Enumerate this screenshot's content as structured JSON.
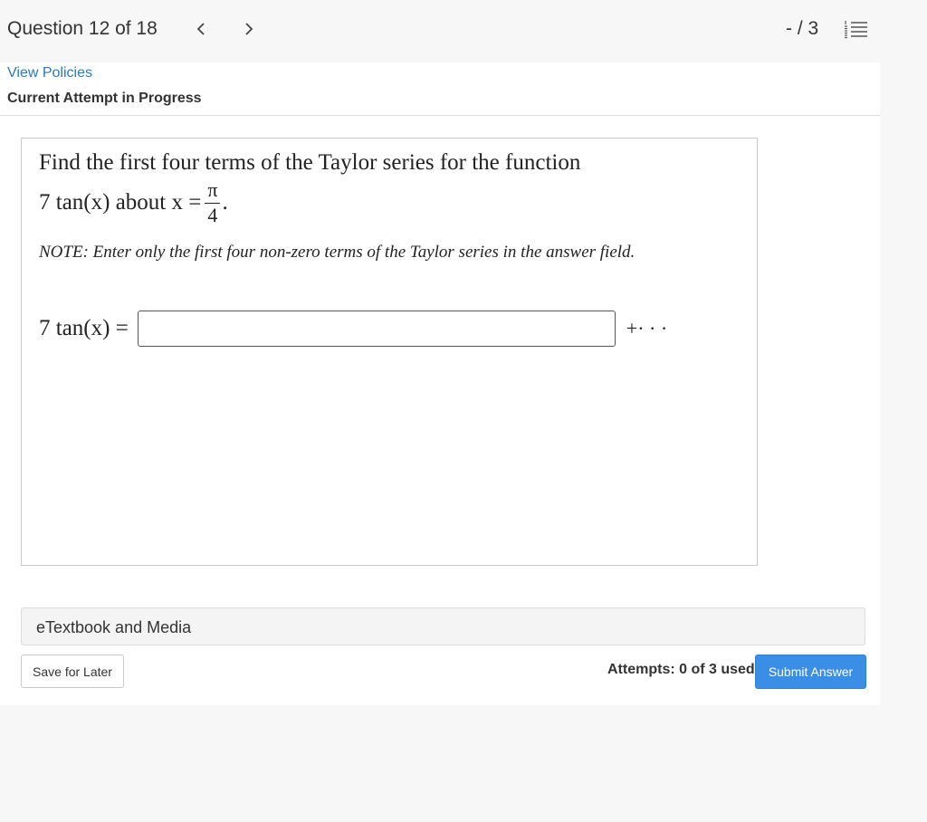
{
  "header": {
    "question_label": "Question 12 of 18",
    "prev_icon": "chevron-left-icon",
    "next_icon": "chevron-right-icon",
    "score": "- / 3",
    "list_icon": "numbered-list-icon"
  },
  "card": {
    "policies_link": "View Policies",
    "attempt_status": "Current Attempt in Progress"
  },
  "question": {
    "line1": "Find the first four terms of the Taylor series for the function",
    "line2_pre": "7 tan(x) about x =",
    "frac_num": "π",
    "frac_den": "4",
    "line2_post": ".",
    "note": "NOTE: Enter only the first four non-zero terms of the Taylor series in the answer field.",
    "answer_lhs": "7 tan(x) =",
    "answer_value": "",
    "answer_suffix": "+· · ·"
  },
  "etextbook": {
    "label": "eTextbook and Media"
  },
  "footer": {
    "save_label": "Save for Later",
    "attempts_text": "Attempts: 0 of 3 used",
    "submit_label": "Submit Answer"
  },
  "colors": {
    "link": "#2a7bb8",
    "submit_bg": "#3a8ee6",
    "page_bg": "#f7f7f7"
  }
}
